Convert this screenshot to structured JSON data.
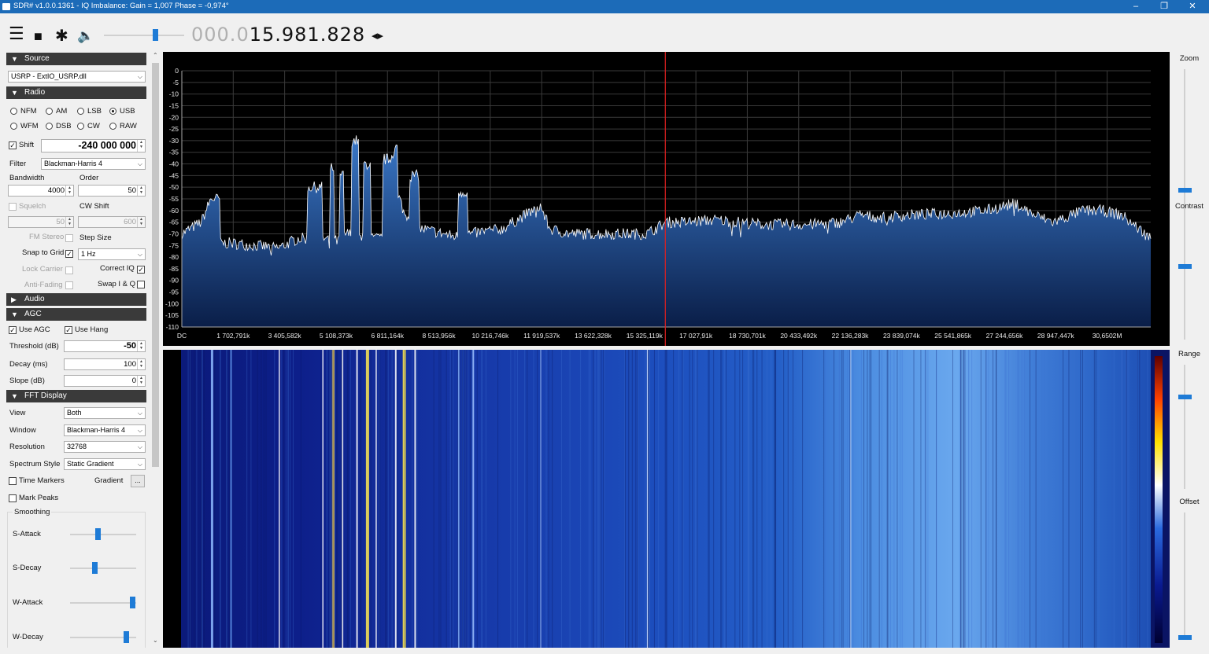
{
  "window": {
    "title": "SDR# v1.0.0.1361 - IQ Imbalance: Gain = 1,007 Phase = -0,974°",
    "minimize": "–",
    "restore": "❐",
    "close": "✕"
  },
  "toolbar": {
    "menu_icon": "☰",
    "stop_icon": "■",
    "settings_icon": "✱",
    "volume_icon": "🔈",
    "volume_level": 0.62,
    "freq_dim": "000.0",
    "freq_lit": "15.981.828",
    "tune_arrows": "◂▸"
  },
  "source": {
    "title": "Source",
    "device": "USRP - ExtIO_USRP.dll"
  },
  "radio": {
    "title": "Radio",
    "modes_row1": [
      "NFM",
      "AM",
      "LSB",
      "USB"
    ],
    "modes_row2": [
      "WFM",
      "DSB",
      "CW",
      "RAW"
    ],
    "selected_mode": "USB",
    "shift_label": "Shift",
    "shift_value": "-240 000 000",
    "filter_label": "Filter",
    "filter_value": "Blackman-Harris 4",
    "bandwidth_label": "Bandwidth",
    "bandwidth_value": "4000",
    "order_label": "Order",
    "order_value": "50",
    "squelch_label": "Squelch",
    "squelch_value": "50",
    "cwshift_label": "CW Shift",
    "cwshift_value": "600",
    "fmstereo_label": "FM Stereo",
    "stepsize_label": "Step Size",
    "snap_label": "Snap to Grid",
    "step_value": "1 Hz",
    "lockcarrier_label": "Lock Carrier",
    "correctiq_label": "Correct IQ",
    "antifading_label": "Anti-Fading",
    "swapiq_label": "Swap I & Q"
  },
  "audio": {
    "title": "Audio"
  },
  "agc": {
    "title": "AGC",
    "use_agc_label": "Use AGC",
    "use_hang_label": "Use Hang",
    "threshold_label": "Threshold (dB)",
    "threshold_value": "-50",
    "decay_label": "Decay (ms)",
    "decay_value": "100",
    "slope_label": "Slope (dB)",
    "slope_value": "0"
  },
  "fft": {
    "title": "FFT Display",
    "view_label": "View",
    "view_value": "Both",
    "window_label": "Window",
    "window_value": "Blackman-Harris 4",
    "resolution_label": "Resolution",
    "resolution_value": "32768",
    "style_label": "Spectrum Style",
    "style_value": "Static Gradient",
    "time_markers_label": "Time Markers",
    "gradient_label": "Gradient",
    "gradient_button": "...",
    "mark_peaks_label": "Mark Peaks",
    "smoothing_label": "Smoothing",
    "sattack_label": "S-Attack",
    "sdecay_label": "S-Decay",
    "wattack_label": "W-Attack",
    "wdecay_label": "W-Decay",
    "sattack_level": 0.4,
    "sdecay_level": 0.35,
    "wattack_level": 0.95,
    "wdecay_level": 0.85
  },
  "right_panel": {
    "zoom_label": "Zoom",
    "contrast_label": "Contrast",
    "range_label": "Range",
    "offset_label": "Offset",
    "zoom_level": 0.0,
    "contrast_level": 0.5,
    "range_level": 0.5,
    "offset_level": 0.0
  },
  "chart_data": {
    "type": "line",
    "title": "",
    "xlabel": "",
    "ylabel": "",
    "y_ticks": [
      "0",
      "-5",
      "-10",
      "-15",
      "-20",
      "-25",
      "-30",
      "-35",
      "-40",
      "-45",
      "-50",
      "-55",
      "-60",
      "-65",
      "-70",
      "-75",
      "-80",
      "-85",
      "-90",
      "-95",
      "-100",
      "-105",
      "-110"
    ],
    "ylim": [
      -110,
      0
    ],
    "x_ticks": [
      "DC",
      "1 702,791k",
      "3 405,582k",
      "5 108,373k",
      "6 811,164k",
      "8 513,956k",
      "10 216,746k",
      "11 919,537k",
      "13 622,328k",
      "15 325,119k",
      "17 027,91k",
      "18 730,701k",
      "20 433,492k",
      "22 136,283k",
      "23 839,074k",
      "25 541,865k",
      "27 244,656k",
      "28 947,447k",
      "30,6502M"
    ],
    "tuned_frequency_fraction": 0.499,
    "series": [
      {
        "x": [
          0,
          0.02,
          0.03,
          0.05,
          0.1,
          0.12,
          0.14,
          0.15,
          0.155,
          0.16,
          0.165,
          0.17,
          0.18,
          0.185,
          0.19,
          0.2,
          0.215,
          0.22,
          0.225,
          0.23,
          0.24,
          0.25,
          0.28,
          0.29,
          0.3,
          0.31,
          0.33,
          0.37,
          0.38,
          0.4,
          0.48,
          0.5,
          0.52,
          0.55,
          0.6,
          0.65,
          0.68,
          0.7,
          0.72,
          0.75,
          0.8,
          0.83,
          0.86,
          0.88,
          0.9,
          0.93,
          0.95,
          0.97,
          1.0
        ],
        "values": [
          -70,
          -65,
          -55,
          -74,
          -76,
          -72,
          -50,
          -72,
          -42,
          -73,
          -45,
          -70,
          -30,
          -72,
          -40,
          -72,
          -38,
          -33,
          -55,
          -62,
          -45,
          -68,
          -71,
          -52,
          -70,
          -69,
          -68,
          -58,
          -68,
          -70,
          -70,
          -65,
          -65,
          -64,
          -66,
          -66,
          -65,
          -62,
          -63,
          -62,
          -61,
          -60,
          -57,
          -62,
          -65,
          -60,
          -60,
          -62,
          -72
        ]
      }
    ]
  }
}
